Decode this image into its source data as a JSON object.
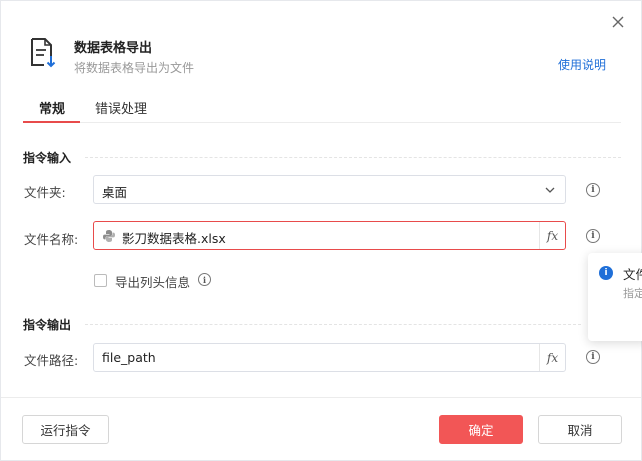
{
  "header": {
    "title": "数据表格导出",
    "subtitle": "将数据表格导出为文件",
    "help_link": "使用说明"
  },
  "tabs": [
    {
      "label": "常规",
      "active": true
    },
    {
      "label": "错误处理",
      "active": false
    }
  ],
  "sections": {
    "input": "指令输入",
    "output": "指令输出"
  },
  "fields": {
    "folder": {
      "label": "文件夹:",
      "value": "桌面"
    },
    "filename": {
      "label": "文件名称:",
      "value": "影刀数据表格.xlsx",
      "fx": "fx"
    },
    "export_header": {
      "label": "导出列头信息",
      "checked": false
    },
    "path": {
      "label": "文件路径:",
      "value": "file_path",
      "fx": "fx"
    }
  },
  "tooltip": {
    "title": "文件",
    "desc": "指定"
  },
  "footer": {
    "run": "运行指令",
    "ok": "确定",
    "cancel": "取消"
  },
  "colors": {
    "accent": "#f25656",
    "link": "#1f6fd8"
  },
  "icons": {
    "header": "document-export-icon",
    "close": "close-icon",
    "chevron": "chevron-down-icon",
    "info": "info-icon",
    "python": "python-icon"
  }
}
